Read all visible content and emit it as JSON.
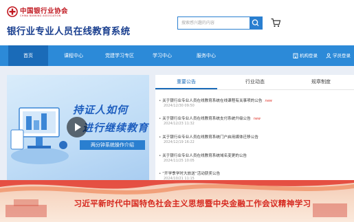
{
  "header": {
    "org_name_cn": "中国银行业协会",
    "org_name_en": "CHINA BANKING ASSOCIATION",
    "site_title": "银行业专业人员在线教育系统",
    "search_placeholder": "搜索感兴趣的内容"
  },
  "nav": {
    "items": [
      {
        "label": "首页"
      },
      {
        "label": "课程中心"
      },
      {
        "label": "党建学习专区"
      },
      {
        "label": "学习中心"
      },
      {
        "label": "服务中心"
      }
    ],
    "org_login": "机构登录",
    "student_login": "学员登录"
  },
  "banner": {
    "line1": "持证人如何",
    "line2": "进行继续教育",
    "subtitle": "两分钟系统操作介绍"
  },
  "tabs": [
    {
      "label": "重要公告"
    },
    {
      "label": "行业动态"
    },
    {
      "label": "规章制度"
    }
  ],
  "news": [
    {
      "title": "关于银行业专业人员在线教育系统在线课程有关事项的公告",
      "date": "2024/12/30 09:50",
      "tag": "new"
    },
    {
      "title": "关于银行业专业人员在线教育系统支付系统升级公告",
      "date": "2024/12/23 11:32",
      "tag": "new"
    },
    {
      "title": "关于银行业专业人员在线教育系统门户启用媒体迁移公告",
      "date": "2024/12/19 16:22",
      "tag": ""
    },
    {
      "title": "关于银行业专业人员在线教育系统域名变更的公告",
      "date": "2024/11/25 10:05",
      "tag": ""
    },
    {
      "title": "“开学季学时大放送”活动获奖公告",
      "date": "2024/10/21 11:15",
      "tag": ""
    }
  ],
  "bottom_banner": {
    "text": "习近平新时代中国特色社会主义思想暨中央金融工作会议精神学习"
  },
  "colors": {
    "brand_red": "#c0161e",
    "nav_blue": "#2c8ad8",
    "nav_active": "#1a6bb8",
    "title_blue": "#1a3f8f"
  }
}
